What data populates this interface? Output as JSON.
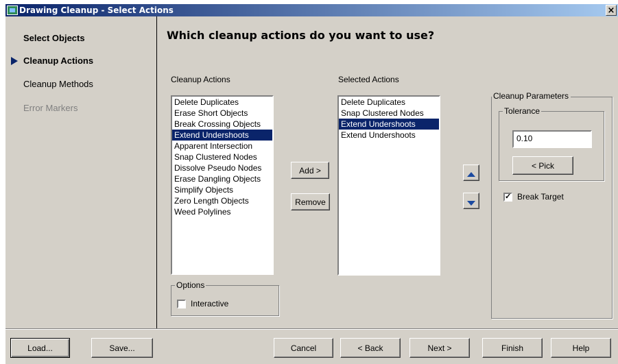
{
  "window": {
    "title": "Drawing Cleanup - Select Actions",
    "close_label": "×"
  },
  "nav": {
    "items": [
      {
        "label": "Select Objects"
      },
      {
        "label": "Cleanup Actions"
      },
      {
        "label": "Cleanup Methods"
      },
      {
        "label": "Error Markers"
      }
    ],
    "current": "Cleanup Actions"
  },
  "main": {
    "heading": "Which cleanup actions do you want to use?",
    "available_label": "Cleanup Actions",
    "available_items": [
      "Delete Duplicates",
      "Erase Short Objects",
      "Break Crossing Objects",
      "Extend Undershoots",
      "Apparent Intersection",
      "Snap Clustered Nodes",
      "Dissolve Pseudo Nodes",
      "Erase Dangling Objects",
      "Simplify Objects",
      "Zero Length Objects",
      "Weed Polylines"
    ],
    "available_selected": "Extend Undershoots",
    "add_label": "Add >",
    "remove_label": "Remove",
    "selected_label": "Selected Actions",
    "selected_items": [
      "Delete Duplicates",
      "Snap Clustered Nodes",
      "Extend Undershoots",
      "Extend Undershoots"
    ],
    "selected_selected_index": 2,
    "options": {
      "group_label": "Options",
      "interactive_label": "Interactive",
      "interactive_checked": false
    },
    "params": {
      "group_label": "Cleanup Parameters",
      "tolerance_label": "Tolerance",
      "tolerance_value": "0.10",
      "pick_label": "< Pick",
      "break_target_label": "Break Target",
      "break_target_checked": true
    }
  },
  "footer": {
    "load_label": "Load...",
    "save_label": "Save...",
    "cancel_label": "Cancel",
    "back_label": "< Back",
    "next_label": "Next >",
    "finish_label": "Finish",
    "help_label": "Help"
  },
  "colors": {
    "selection": "#0a246a",
    "face": "#d4d0c8",
    "arrow": "#1b4aa0"
  }
}
